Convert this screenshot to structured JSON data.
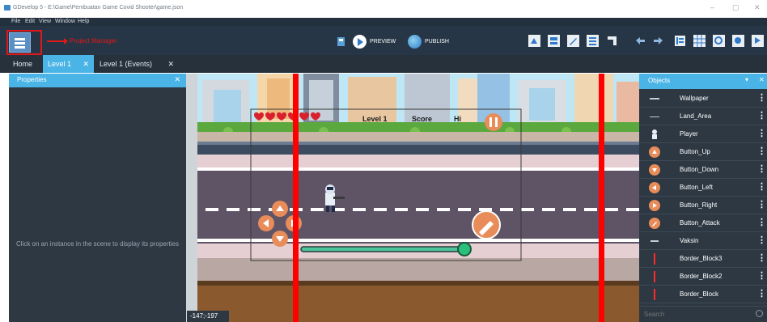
{
  "window": {
    "title": "GDevelop 5 - E:\\Game\\Pembuatan Game Covid Shooter\\game.json",
    "minimize": "–",
    "maximize": "▢",
    "close": "✕"
  },
  "menu": [
    "File",
    "Edit",
    "View",
    "Window",
    "Help"
  ],
  "toolbar": {
    "project_manager_annotation": "Project Manager",
    "preview_label": "PREVIEW",
    "publish_label": "PUBLISH"
  },
  "tabs": [
    {
      "label": "Home",
      "closable": false,
      "active": false
    },
    {
      "label": "Level 1",
      "closable": true,
      "active": true
    },
    {
      "label": "Level 1 (Events)",
      "closable": true,
      "active": false
    }
  ],
  "tab_close_glyph": "✕",
  "properties": {
    "title": "Properties",
    "close": "✕",
    "empty_message": "Click on an instance in the scene to display its properties"
  },
  "scene": {
    "hud": {
      "hearts": 6,
      "level_text": "Level 1",
      "score_text": "Score",
      "hi_text": "Hi"
    },
    "cursor_coords": "-147;-197"
  },
  "objects_panel": {
    "title": "Objects",
    "items": [
      {
        "name": "Wallpaper",
        "icon": "line-icon"
      },
      {
        "name": "Land_Area",
        "icon": "line-icon"
      },
      {
        "name": "Player",
        "icon": "player-icon"
      },
      {
        "name": "Button_Up",
        "icon": "arrow-up-button-icon"
      },
      {
        "name": "Button_Down",
        "icon": "arrow-down-button-icon"
      },
      {
        "name": "Button_Left",
        "icon": "arrow-left-button-icon"
      },
      {
        "name": "Button_Right",
        "icon": "arrow-right-button-icon"
      },
      {
        "name": "Button_Attack",
        "icon": "syringe-button-icon"
      },
      {
        "name": "Vaksin",
        "icon": "vaccine-icon"
      },
      {
        "name": "Border_Block3",
        "icon": "red-bar-icon"
      },
      {
        "name": "Border_Block2",
        "icon": "red-bar-icon"
      },
      {
        "name": "Border_Block",
        "icon": "red-bar-icon"
      }
    ],
    "kebab": "⋮",
    "search_placeholder": "Search"
  },
  "colors": {
    "accent": "#4bb4e6",
    "panel": "#2d3843",
    "toolbar": "#263646",
    "annotation_red": "#e01818",
    "border_block": "#ff0000",
    "button_orange": "#e88c5a"
  }
}
